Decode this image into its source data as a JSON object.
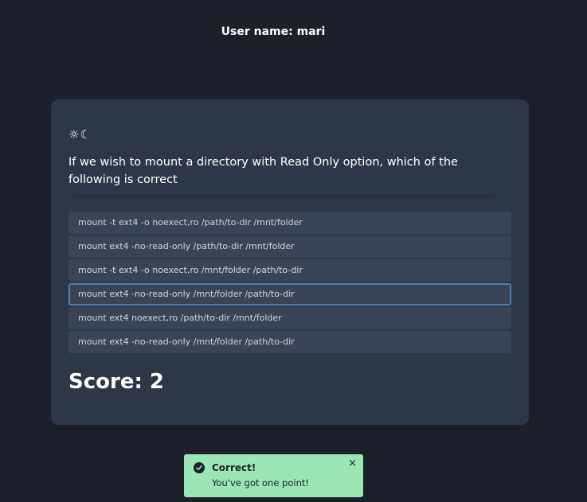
{
  "header": {
    "username_label": "User name: mari"
  },
  "quiz": {
    "theme_toggle": {
      "sun_icon": "☼",
      "moon_icon": "☾"
    },
    "question": "If we wish to mount a directory with Read Only option, which of the following is correct",
    "options": [
      "mount -t ext4 -o noexect,ro /path/to-dir /mnt/folder",
      "mount ext4 -no-read-only /path/to-dir /mnt/folder",
      "mount -t ext4 -o noexect,ro /mnt/folder /path/to-dir",
      "mount ext4 -no-read-only /mnt/folder /path/to-dir",
      "mount ext4 noexect,ro /path/to-dir /mnt/folder",
      "mount ext4 -no-read-only /mnt/folder /path/to-dir"
    ],
    "selected_index": 3,
    "score_label": "Score: 2"
  },
  "toast": {
    "title": "Correct!",
    "description": "You've got one point!",
    "close_icon": "×",
    "status_color": "#9ae6b4"
  }
}
